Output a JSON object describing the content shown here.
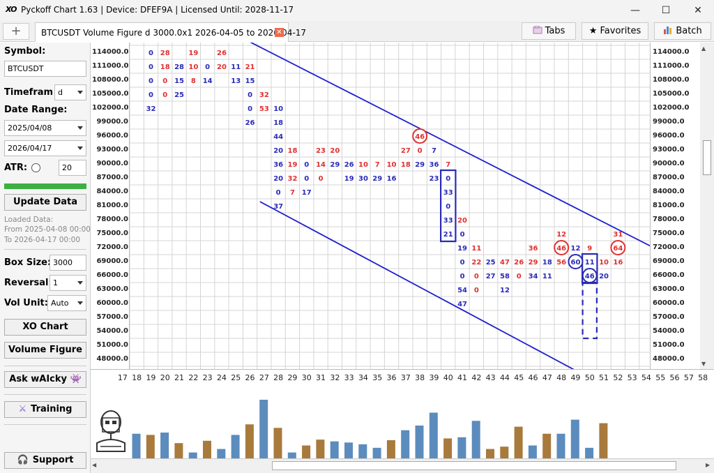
{
  "window": {
    "logo": "XO",
    "title": "Pyckoff Chart 1.63 | Device: DFEF9A | Licensed Until: 2028-11-17",
    "minimize": "—",
    "maximize": "☐",
    "close": "✕"
  },
  "tabbar": {
    "add": "+",
    "tab_label": "BTCUSDT Volume Figure d 3000.0x1 2026-04-05 to 2026-04-17",
    "tab_close": "✕",
    "tabs": "Tabs",
    "favorites": "★ Favorites",
    "batch": "Batch"
  },
  "sidebar": {
    "symbol_label": "Symbol:",
    "symbol_value": "BTCUSDT",
    "timeframe_label": "Timefram",
    "timeframe_value": "d",
    "date_range_label": "Date Range:",
    "date_from": "2025/04/08",
    "date_to": "2026/04/17",
    "atr_label": "ATR:",
    "atr_value": "20",
    "update_button": "Update Data",
    "loaded_label": "Loaded Data:",
    "loaded_from": "From 2025-04-08 00:00",
    "loaded_to": "To 2026-04-17 00:00",
    "boxsize_label": "Box Size:",
    "boxsize_value": "3000",
    "reversal_label": "Reversal:",
    "reversal_value": "1",
    "volunit_label": "Vol Unit:",
    "volunit_value": "Auto",
    "xo_button": "XO Chart",
    "volfig_button": "Volume Figure",
    "ask_button": "Ask wAIcky 👾",
    "training_button": "Training",
    "support_button": "Support"
  },
  "colors": {
    "red": "#e03030",
    "blue": "#2a2ab8",
    "vol_blue": "#5b8cbd",
    "vol_brown": "#a87a3c",
    "accent_green": "#3cb043",
    "line_blue": "#1e1ed2"
  },
  "chart": {
    "y_labels": [
      "114000.0",
      "111000.0",
      "108000.0",
      "105000.0",
      "102000.0",
      "99000.0",
      "96000.0",
      "93000.0",
      "90000.0",
      "87000.0",
      "84000.0",
      "81000.0",
      "78000.0",
      "75000.0",
      "72000.0",
      "69000.0",
      "66000.0",
      "63000.0",
      "60000.0",
      "57000.0",
      "54000.0",
      "51000.0",
      "48000.0"
    ],
    "x_labels": [
      "17",
      "18",
      "19",
      "20",
      "21",
      "22",
      "23",
      "24",
      "25",
      "26",
      "27",
      "28",
      "29",
      "30",
      "31",
      "32",
      "33",
      "34",
      "35",
      "36",
      "37",
      "38",
      "39",
      "40",
      "41",
      "42",
      "43",
      "44",
      "45",
      "46",
      "47",
      "48",
      "49",
      "50",
      "51",
      "52",
      "53",
      "54",
      "55",
      "56",
      "57",
      "58"
    ],
    "cells": [
      {
        "c": 1,
        "r": 0,
        "t": "0",
        "k": "b"
      },
      {
        "c": 2,
        "r": 0,
        "t": "28",
        "k": "r"
      },
      {
        "c": 4,
        "r": 0,
        "t": "19",
        "k": "r"
      },
      {
        "c": 6,
        "r": 0,
        "t": "26",
        "k": "r"
      },
      {
        "c": 1,
        "r": 1,
        "t": "0",
        "k": "b"
      },
      {
        "c": 2,
        "r": 1,
        "t": "18",
        "k": "r"
      },
      {
        "c": 3,
        "r": 1,
        "t": "28",
        "k": "b"
      },
      {
        "c": 4,
        "r": 1,
        "t": "10",
        "k": "r"
      },
      {
        "c": 5,
        "r": 1,
        "t": "0",
        "k": "b"
      },
      {
        "c": 6,
        "r": 1,
        "t": "20",
        "k": "r"
      },
      {
        "c": 7,
        "r": 1,
        "t": "11",
        "k": "b"
      },
      {
        "c": 8,
        "r": 1,
        "t": "21",
        "k": "r"
      },
      {
        "c": 1,
        "r": 2,
        "t": "0",
        "k": "b"
      },
      {
        "c": 2,
        "r": 2,
        "t": "0",
        "k": "r"
      },
      {
        "c": 3,
        "r": 2,
        "t": "15",
        "k": "b"
      },
      {
        "c": 4,
        "r": 2,
        "t": "8",
        "k": "r"
      },
      {
        "c": 5,
        "r": 2,
        "t": "14",
        "k": "b"
      },
      {
        "c": 7,
        "r": 2,
        "t": "13",
        "k": "b"
      },
      {
        "c": 8,
        "r": 2,
        "t": "15",
        "k": "b"
      },
      {
        "c": 1,
        "r": 3,
        "t": "0",
        "k": "b"
      },
      {
        "c": 2,
        "r": 3,
        "t": "0",
        "k": "r"
      },
      {
        "c": 3,
        "r": 3,
        "t": "25",
        "k": "b"
      },
      {
        "c": 8,
        "r": 3,
        "t": "0",
        "k": "b"
      },
      {
        "c": 9,
        "r": 3,
        "t": "32",
        "k": "r"
      },
      {
        "c": 1,
        "r": 4,
        "t": "32",
        "k": "b"
      },
      {
        "c": 8,
        "r": 4,
        "t": "0",
        "k": "b"
      },
      {
        "c": 9,
        "r": 4,
        "t": "53",
        "k": "r"
      },
      {
        "c": 10,
        "r": 4,
        "t": "10",
        "k": "b"
      },
      {
        "c": 8,
        "r": 5,
        "t": "26",
        "k": "b"
      },
      {
        "c": 10,
        "r": 5,
        "t": "18",
        "k": "b"
      },
      {
        "c": 10,
        "r": 6,
        "t": "44",
        "k": "b"
      },
      {
        "c": 20,
        "r": 6,
        "t": "46",
        "k": "r"
      },
      {
        "c": 10,
        "r": 7,
        "t": "20",
        "k": "b"
      },
      {
        "c": 11,
        "r": 7,
        "t": "18",
        "k": "r"
      },
      {
        "c": 13,
        "r": 7,
        "t": "23",
        "k": "r"
      },
      {
        "c": 14,
        "r": 7,
        "t": "20",
        "k": "r"
      },
      {
        "c": 19,
        "r": 7,
        "t": "27",
        "k": "r"
      },
      {
        "c": 20,
        "r": 7,
        "t": "0",
        "k": "r"
      },
      {
        "c": 21,
        "r": 7,
        "t": "7",
        "k": "b"
      },
      {
        "c": 10,
        "r": 8,
        "t": "36",
        "k": "b"
      },
      {
        "c": 11,
        "r": 8,
        "t": "19",
        "k": "r"
      },
      {
        "c": 12,
        "r": 8,
        "t": "0",
        "k": "b"
      },
      {
        "c": 13,
        "r": 8,
        "t": "14",
        "k": "r"
      },
      {
        "c": 14,
        "r": 8,
        "t": "29",
        "k": "b"
      },
      {
        "c": 15,
        "r": 8,
        "t": "26",
        "k": "b"
      },
      {
        "c": 16,
        "r": 8,
        "t": "10",
        "k": "r"
      },
      {
        "c": 17,
        "r": 8,
        "t": "7",
        "k": "r"
      },
      {
        "c": 18,
        "r": 8,
        "t": "10",
        "k": "r"
      },
      {
        "c": 19,
        "r": 8,
        "t": "18",
        "k": "r"
      },
      {
        "c": 20,
        "r": 8,
        "t": "29",
        "k": "b"
      },
      {
        "c": 21,
        "r": 8,
        "t": "36",
        "k": "b"
      },
      {
        "c": 22,
        "r": 8,
        "t": "7",
        "k": "r"
      },
      {
        "c": 10,
        "r": 9,
        "t": "20",
        "k": "b"
      },
      {
        "c": 11,
        "r": 9,
        "t": "32",
        "k": "r"
      },
      {
        "c": 12,
        "r": 9,
        "t": "0",
        "k": "b"
      },
      {
        "c": 13,
        "r": 9,
        "t": "0",
        "k": "r"
      },
      {
        "c": 15,
        "r": 9,
        "t": "19",
        "k": "b"
      },
      {
        "c": 16,
        "r": 9,
        "t": "30",
        "k": "b"
      },
      {
        "c": 17,
        "r": 9,
        "t": "29",
        "k": "b"
      },
      {
        "c": 18,
        "r": 9,
        "t": "16",
        "k": "b"
      },
      {
        "c": 21,
        "r": 9,
        "t": "23",
        "k": "b"
      },
      {
        "c": 22,
        "r": 9,
        "t": "0",
        "k": "b"
      },
      {
        "c": 10,
        "r": 10,
        "t": "0",
        "k": "b"
      },
      {
        "c": 11,
        "r": 10,
        "t": "7",
        "k": "r"
      },
      {
        "c": 12,
        "r": 10,
        "t": "17",
        "k": "b"
      },
      {
        "c": 22,
        "r": 10,
        "t": "33",
        "k": "b"
      },
      {
        "c": 10,
        "r": 11,
        "t": "37",
        "k": "b"
      },
      {
        "c": 22,
        "r": 11,
        "t": "0",
        "k": "b"
      },
      {
        "c": 22,
        "r": 12,
        "t": "33",
        "k": "b"
      },
      {
        "c": 23,
        "r": 12,
        "t": "20",
        "k": "r"
      },
      {
        "c": 22,
        "r": 13,
        "t": "21",
        "k": "b"
      },
      {
        "c": 23,
        "r": 13,
        "t": "0",
        "k": "b"
      },
      {
        "c": 30,
        "r": 13,
        "t": "12",
        "k": "r"
      },
      {
        "c": 34,
        "r": 13,
        "t": "31",
        "k": "r"
      },
      {
        "c": 23,
        "r": 14,
        "t": "19",
        "k": "b"
      },
      {
        "c": 24,
        "r": 14,
        "t": "11",
        "k": "r"
      },
      {
        "c": 28,
        "r": 14,
        "t": "36",
        "k": "r"
      },
      {
        "c": 30,
        "r": 14,
        "t": "46",
        "k": "r"
      },
      {
        "c": 31,
        "r": 14,
        "t": "12",
        "k": "b"
      },
      {
        "c": 32,
        "r": 14,
        "t": "9",
        "k": "r"
      },
      {
        "c": 34,
        "r": 14,
        "t": "64",
        "k": "r"
      },
      {
        "c": 23,
        "r": 15,
        "t": "0",
        "k": "b"
      },
      {
        "c": 24,
        "r": 15,
        "t": "22",
        "k": "r"
      },
      {
        "c": 25,
        "r": 15,
        "t": "25",
        "k": "b"
      },
      {
        "c": 26,
        "r": 15,
        "t": "47",
        "k": "r"
      },
      {
        "c": 27,
        "r": 15,
        "t": "26",
        "k": "r"
      },
      {
        "c": 28,
        "r": 15,
        "t": "29",
        "k": "r"
      },
      {
        "c": 29,
        "r": 15,
        "t": "18",
        "k": "b"
      },
      {
        "c": 30,
        "r": 15,
        "t": "56",
        "k": "r"
      },
      {
        "c": 31,
        "r": 15,
        "t": "60",
        "k": "b"
      },
      {
        "c": 32,
        "r": 15,
        "t": "11",
        "k": "b"
      },
      {
        "c": 33,
        "r": 15,
        "t": "10",
        "k": "r"
      },
      {
        "c": 34,
        "r": 15,
        "t": "16",
        "k": "r"
      },
      {
        "c": 23,
        "r": 16,
        "t": "0",
        "k": "b"
      },
      {
        "c": 24,
        "r": 16,
        "t": "0",
        "k": "r"
      },
      {
        "c": 25,
        "r": 16,
        "t": "27",
        "k": "b"
      },
      {
        "c": 26,
        "r": 16,
        "t": "58",
        "k": "b"
      },
      {
        "c": 27,
        "r": 16,
        "t": "0",
        "k": "r"
      },
      {
        "c": 28,
        "r": 16,
        "t": "34",
        "k": "b"
      },
      {
        "c": 29,
        "r": 16,
        "t": "11",
        "k": "b"
      },
      {
        "c": 32,
        "r": 16,
        "t": "46",
        "k": "b"
      },
      {
        "c": 33,
        "r": 16,
        "t": "20",
        "k": "b"
      },
      {
        "c": 23,
        "r": 17,
        "t": "54",
        "k": "b"
      },
      {
        "c": 24,
        "r": 17,
        "t": "0",
        "k": "r"
      },
      {
        "c": 26,
        "r": 17,
        "t": "12",
        "k": "b"
      },
      {
        "c": 23,
        "r": 18,
        "t": "47",
        "k": "b"
      }
    ],
    "circles": [
      {
        "c": 20,
        "r": 6,
        "k": "r"
      },
      {
        "c": 30,
        "r": 14,
        "k": "r"
      },
      {
        "c": 34,
        "r": 14,
        "k": "r"
      },
      {
        "c": 31,
        "r": 15,
        "k": "b"
      },
      {
        "c": 32,
        "r": 16,
        "k": "b"
      }
    ],
    "rects": [
      {
        "c": 22,
        "r0": 9,
        "r1": 13
      },
      {
        "c": 32,
        "r0": 15,
        "r1": 16
      }
    ],
    "dashed": {
      "c": 32,
      "r0": 17,
      "r1": 20
    },
    "lines": [
      {
        "c0": 8,
        "r0": -0.5,
        "c1": 40.3,
        "r1": 16.2
      },
      {
        "c0": 9.2,
        "r0": 11.2,
        "c1": 31.5,
        "r1": 23.3
      }
    ],
    "volumes": [
      {
        "v": 0.42,
        "k": "b"
      },
      {
        "v": 0.4,
        "k": "br"
      },
      {
        "v": 0.44,
        "k": "b"
      },
      {
        "v": 0.26,
        "k": "br"
      },
      {
        "v": 0.1,
        "k": "b"
      },
      {
        "v": 0.3,
        "k": "br"
      },
      {
        "v": 0.16,
        "k": "b"
      },
      {
        "v": 0.4,
        "k": "b"
      },
      {
        "v": 0.58,
        "k": "br"
      },
      {
        "v": 1.0,
        "k": "b"
      },
      {
        "v": 0.52,
        "k": "br"
      },
      {
        "v": 0.1,
        "k": "b"
      },
      {
        "v": 0.22,
        "k": "br"
      },
      {
        "v": 0.32,
        "k": "br"
      },
      {
        "v": 0.29,
        "k": "b"
      },
      {
        "v": 0.27,
        "k": "b"
      },
      {
        "v": 0.24,
        "k": "b"
      },
      {
        "v": 0.18,
        "k": "b"
      },
      {
        "v": 0.31,
        "k": "br"
      },
      {
        "v": 0.48,
        "k": "b"
      },
      {
        "v": 0.56,
        "k": "b"
      },
      {
        "v": 0.78,
        "k": "b"
      },
      {
        "v": 0.34,
        "k": "br"
      },
      {
        "v": 0.36,
        "k": "b"
      },
      {
        "v": 0.64,
        "k": "b"
      },
      {
        "v": 0.16,
        "k": "br"
      },
      {
        "v": 0.2,
        "k": "br"
      },
      {
        "v": 0.54,
        "k": "br"
      },
      {
        "v": 0.22,
        "k": "b"
      },
      {
        "v": 0.42,
        "k": "br"
      },
      {
        "v": 0.42,
        "k": "b"
      },
      {
        "v": 0.66,
        "k": "b"
      },
      {
        "v": 0.18,
        "k": "b"
      },
      {
        "v": 0.6,
        "k": "br"
      }
    ]
  }
}
